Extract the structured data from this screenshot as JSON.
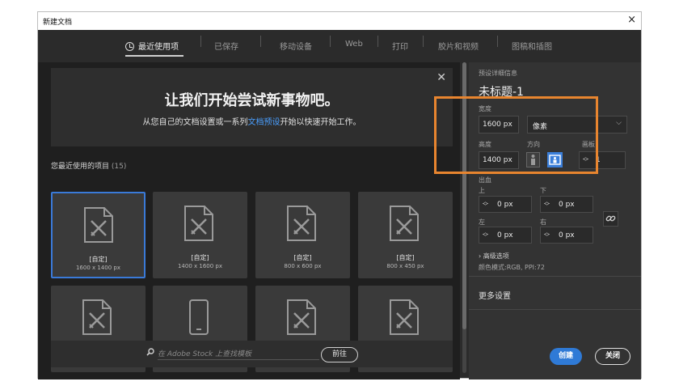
{
  "window": {
    "title": "新建文档",
    "close_glyph": "×"
  },
  "tabs": [
    {
      "label": "最近使用项",
      "active": true,
      "icon": "clock-icon"
    },
    {
      "label": "已保存"
    },
    {
      "label": "移动设备"
    },
    {
      "label": "Web"
    },
    {
      "label": "打印"
    },
    {
      "label": "胶片和视频"
    },
    {
      "label": "图稿和插图"
    }
  ],
  "banner": {
    "heading": "让我们开始尝试新事物吧。",
    "sub_before": "从您自己的文档设置或一系列",
    "sub_link": "文档预设",
    "sub_after": "开始以快速开始工作。",
    "close_glyph": "✕"
  },
  "recent": {
    "title": "您最近使用的项目",
    "count": "(15)",
    "items": [
      {
        "label": "[自定]",
        "size": "1600 x 1400 px",
        "icon": "document-icon"
      },
      {
        "label": "[自定]",
        "size": "1400 x 1600 px",
        "icon": "document-icon"
      },
      {
        "label": "[自定]",
        "size": "800 x 600 px",
        "icon": "document-icon"
      },
      {
        "label": "[自定]",
        "size": "800 x 450 px",
        "icon": "document-icon"
      },
      {
        "label": "",
        "size": "",
        "icon": "document-icon"
      },
      {
        "label": "",
        "size": "",
        "icon": "mobile-device-icon"
      },
      {
        "label": "",
        "size": "",
        "icon": "document-icon"
      },
      {
        "label": "",
        "size": "",
        "icon": "document-icon"
      }
    ]
  },
  "stock_search": {
    "placeholder": "在 Adobe Stock 上查找模板",
    "go_label": "前往"
  },
  "preset": {
    "section_label": "预设详细信息",
    "name": "未标题-1",
    "width_label": "宽度",
    "width_value": "1600 px",
    "unit": "像素",
    "height_label": "高度",
    "height_value": "1400 px",
    "orientation_label": "方向",
    "artboard_label": "画板",
    "artboard_value": "1",
    "bleed_label": "出血",
    "top_label": "上",
    "bottom_label": "下",
    "left_label": "左",
    "right_label": "右",
    "top_value": "0 px",
    "bottom_value": "0 px",
    "left_value": "0 px",
    "right_value": "0 px",
    "advanced_label": "高级选项",
    "color_mode": "颜色模式:RGB, PPI:72",
    "more_settings": "更多设置"
  },
  "actions": {
    "create_label": "创建",
    "close_label": "关闭"
  },
  "colors": {
    "accent": "#2f7ad6",
    "highlight": "#e8852f",
    "link": "#4a9fff"
  }
}
